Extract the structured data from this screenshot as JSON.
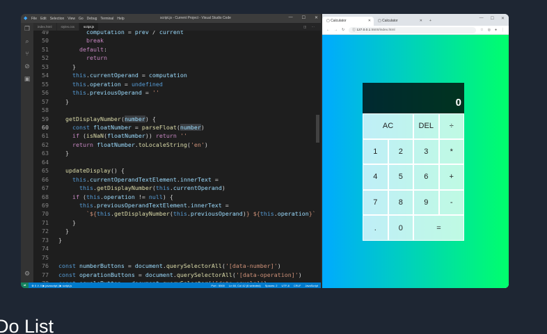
{
  "vscode": {
    "menu": [
      "File",
      "Edit",
      "Selection",
      "View",
      "Go",
      "Debug",
      "Terminal",
      "Help"
    ],
    "window_title": "script.js - Current Project - Visual Studio Code",
    "tabs": [
      {
        "label": "index.html"
      },
      {
        "label": "styles.css"
      },
      {
        "label": "script.js",
        "active": true
      }
    ],
    "status": {
      "left": "⊗ 0 ⚠ 0   ▶ javascript | ▶ script.js",
      "right": [
        "Port : 5500",
        "Ln 60, Col 42 (6 selected)",
        "Spaces: 2",
        "UTF-8",
        "CRLF",
        "JavaScript"
      ]
    },
    "code_lines": [
      {
        "n": "49",
        "html": "        <span class=\"v\">computation</span> = <span class=\"v\">prev</span> / <span class=\"v\">current</span>"
      },
      {
        "n": "50",
        "html": "        <span class=\"k\">break</span>"
      },
      {
        "n": "51",
        "html": "      <span class=\"k\">default</span>:"
      },
      {
        "n": "52",
        "html": "        <span class=\"k\">return</span>"
      },
      {
        "n": "53",
        "html": "    }"
      },
      {
        "n": "54",
        "html": "    <span class=\"b\">this</span>.<span class=\"v\">currentOperand</span> = <span class=\"v\">computation</span>"
      },
      {
        "n": "55",
        "html": "    <span class=\"b\">this</span>.<span class=\"v\">operation</span> = <span class=\"b\">undefined</span>"
      },
      {
        "n": "56",
        "html": "    <span class=\"b\">this</span>.<span class=\"v\">previousOperand</span> = <span class=\"s\">''</span>"
      },
      {
        "n": "57",
        "html": "  }"
      },
      {
        "n": "58",
        "html": ""
      },
      {
        "n": "59",
        "html": "  <span class=\"f\">getDisplayNumber</span>(<span class=\"v hl\">number</span>) {"
      },
      {
        "n": "60",
        "html": "    <span class=\"b\">const</span> <span class=\"v\">floatNumber</span> = <span class=\"f\">parseFloat</span>(<span class=\"v hl\">number</span>)",
        "cur": true
      },
      {
        "n": "61",
        "html": "    <span class=\"k\">if</span> (<span class=\"f\">isNaN</span>(<span class=\"v\">floatNumber</span>)) <span class=\"k\">return</span> <span class=\"s\">''</span>"
      },
      {
        "n": "62",
        "html": "    <span class=\"k\">return</span> <span class=\"v\">floatNumber</span>.<span class=\"f\">toLocaleString</span>(<span class=\"s\">'en'</span>)"
      },
      {
        "n": "63",
        "html": "  }"
      },
      {
        "n": "64",
        "html": ""
      },
      {
        "n": "65",
        "html": "  <span class=\"f\">updateDisplay</span>() {"
      },
      {
        "n": "66",
        "html": "    <span class=\"b\">this</span>.<span class=\"v\">currentOperandTextElement</span>.<span class=\"v\">innerText</span> ="
      },
      {
        "n": "67",
        "html": "      <span class=\"b\">this</span>.<span class=\"f\">getDisplayNumber</span>(<span class=\"b\">this</span>.<span class=\"v\">currentOperand</span>)"
      },
      {
        "n": "68",
        "html": "    <span class=\"k\">if</span> (<span class=\"b\">this</span>.<span class=\"v\">operation</span> != <span class=\"b\">null</span>) {"
      },
      {
        "n": "69",
        "html": "      <span class=\"b\">this</span>.<span class=\"v\">previousOperandTextElement</span>.<span class=\"v\">innerText</span> ="
      },
      {
        "n": "70",
        "html": "        <span class=\"s\">`${</span><span class=\"b\">this</span>.<span class=\"f\">getDisplayNumber</span>(<span class=\"b\">this</span>.<span class=\"v\">previousOperand</span>)<span class=\"s\">} ${</span><span class=\"b\">this</span>.<span class=\"v\">operation</span><span class=\"s\">}`</span>"
      },
      {
        "n": "71",
        "html": "    }"
      },
      {
        "n": "72",
        "html": "  }"
      },
      {
        "n": "73",
        "html": "}"
      },
      {
        "n": "74",
        "html": ""
      },
      {
        "n": "75",
        "html": ""
      },
      {
        "n": "76",
        "html": "<span class=\"b\">const</span> <span class=\"v\">numberButtons</span> = <span class=\"v\">document</span>.<span class=\"f\">querySelectorAll</span>(<span class=\"s\">'[data-number]'</span>)"
      },
      {
        "n": "77",
        "html": "<span class=\"b\">const</span> <span class=\"v\">operationButtons</span> = <span class=\"v\">document</span>.<span class=\"f\">querySelectorAll</span>(<span class=\"s\">'[data-operation]'</span>)"
      },
      {
        "n": "78",
        "html": "<span class=\"b\">const</span> <span class=\"v\">equalsButton</span> = <span class=\"v\">document</span>.<span class=\"f\">querySelector</span>(<span class=\"s\">'[data-equals]'</span>)"
      }
    ]
  },
  "browser": {
    "tabs": [
      {
        "label": "Calculator",
        "active": true
      },
      {
        "label": "Calculator"
      }
    ],
    "url_host": "127.0.0.1",
    "url_path": ":5500/index.html"
  },
  "calculator": {
    "display_value": "0",
    "buttons": [
      {
        "label": "AC",
        "span2": true
      },
      {
        "label": "DEL"
      },
      {
        "label": "÷"
      },
      {
        "label": "1"
      },
      {
        "label": "2"
      },
      {
        "label": "3"
      },
      {
        "label": "*"
      },
      {
        "label": "4"
      },
      {
        "label": "5"
      },
      {
        "label": "6"
      },
      {
        "label": "+"
      },
      {
        "label": "7"
      },
      {
        "label": "8"
      },
      {
        "label": "9"
      },
      {
        "label": "-"
      },
      {
        "label": "."
      },
      {
        "label": "0"
      },
      {
        "label": "=",
        "span2": true
      }
    ]
  },
  "caption": "Do List",
  "colors": {
    "page_background": "#1e2633",
    "gradient_start": "#00aaff",
    "gradient_end": "#00ff6c",
    "vscode_status": "#007acc"
  }
}
